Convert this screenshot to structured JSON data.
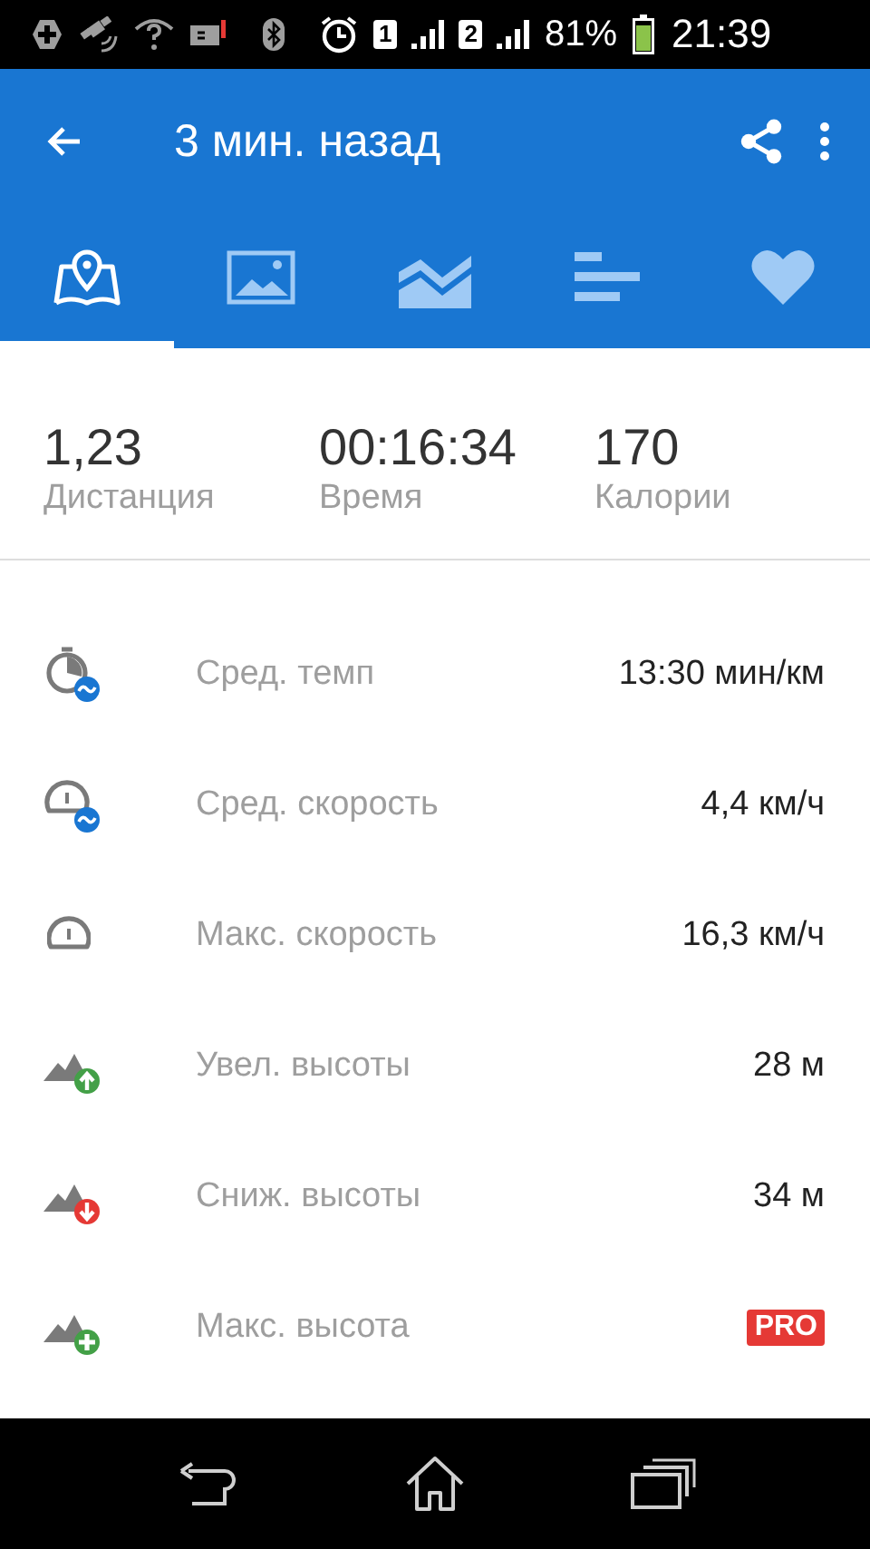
{
  "status_bar": {
    "sim_1": "1",
    "sim_2": "2",
    "battery": "81%",
    "time": "21:39"
  },
  "app_bar": {
    "title": "3 мин. назад"
  },
  "tabs": [
    {
      "kind": "map",
      "selected": true
    },
    {
      "kind": "photos",
      "selected": false
    },
    {
      "kind": "chart",
      "selected": false
    },
    {
      "kind": "splits",
      "selected": false
    },
    {
      "kind": "heart",
      "selected": false
    }
  ],
  "summary": [
    {
      "value": "1,23",
      "label": "Дистанция"
    },
    {
      "value": "00:16:34",
      "label": "Время"
    },
    {
      "value": "170",
      "label": "Калории"
    }
  ],
  "metrics": [
    {
      "kind": "pace",
      "label": "Сред. темп",
      "value": "13:30 мин/км",
      "badge": false
    },
    {
      "kind": "avg_speed",
      "label": "Сред. скорость",
      "value": "4,4 км/ч",
      "badge": false
    },
    {
      "kind": "max_speed",
      "label": "Макс. скорость",
      "value": "16,3 км/ч",
      "badge": false
    },
    {
      "kind": "ascent",
      "label": "Увел. высоты",
      "value": "28 м",
      "badge": false
    },
    {
      "kind": "descent",
      "label": "Сниж. высоты",
      "value": "34 м",
      "badge": false
    },
    {
      "kind": "max_altitude",
      "label": "Макс. высота",
      "value": "PRO",
      "badge": true
    }
  ]
}
